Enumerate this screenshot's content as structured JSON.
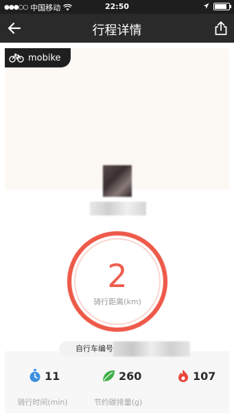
{
  "status_bar": {
    "carrier": "中国移动",
    "time": "22:50",
    "battery_level": 0.85
  },
  "header": {
    "title": "行程详情"
  },
  "brand": {
    "logo_text": "mobike"
  },
  "trip": {
    "distance_value": "2",
    "distance_label": "骑行距离(km)",
    "bike_number_label": "自行车编号"
  },
  "stats": [
    {
      "value": "11",
      "label": "骑行时间(min)",
      "icon": "stopwatch-icon",
      "color": "#3b8fe0"
    },
    {
      "value": "260",
      "label": "节约碳排量(g)",
      "icon": "leaf-icon",
      "color": "#3fae49"
    },
    {
      "value": "107",
      "label": "",
      "icon": "calorie-icon",
      "color": "#e8473a"
    }
  ],
  "colors": {
    "accent": "#ef5d4e",
    "status_bar_bg": "#1e1e1e",
    "nav_bar_bg": "#2a2a2a"
  }
}
